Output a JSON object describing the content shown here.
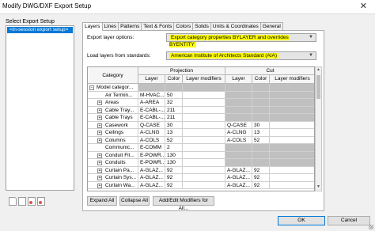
{
  "window": {
    "title": "Modify DWG/DXF Export Setup",
    "close_glyph": "✕"
  },
  "left": {
    "label": "Select Export Setup",
    "items": [
      "<in-session export setup>"
    ]
  },
  "tabs": [
    "Layers",
    "Lines",
    "Patterns",
    "Text & Fonts",
    "Colors",
    "Solids",
    "Units & Coordinates",
    "General"
  ],
  "active_tab": "Layers",
  "export_options": {
    "label": "Export layer options:",
    "value": "Export category properties BYLAYER and overrides BYENTITY"
  },
  "load_layers": {
    "label": "Load layers from standards:",
    "value": "American Institute of Architects Standard (AIA)"
  },
  "table": {
    "header": {
      "category": "Category",
      "projection": "Projection",
      "cut": "Cut",
      "layer": "Layer",
      "color": "Color",
      "layer_modifiers": "Layer modifiers"
    },
    "rows": [
      {
        "level": 0,
        "expander": "−",
        "name": "Model categor...",
        "p_layer": "",
        "p_color": "",
        "c_layer": "",
        "c_color": "",
        "p_grey": false,
        "c_grey": false,
        "section": true
      },
      {
        "level": 1,
        "expander": "",
        "name": "Air Termin...",
        "p_layer": "M-HVAC...",
        "p_color": "50",
        "c_layer": "",
        "c_color": "",
        "c_grey": true
      },
      {
        "level": 1,
        "expander": "+",
        "name": "Areas",
        "p_layer": "A-AREA",
        "p_color": "32",
        "c_layer": "",
        "c_color": "",
        "c_grey": true
      },
      {
        "level": 1,
        "expander": "+",
        "name": "Cable Tray...",
        "p_layer": "E-CABL-...",
        "p_color": "211",
        "c_layer": "",
        "c_color": "",
        "c_grey": true
      },
      {
        "level": 1,
        "expander": "+",
        "name": "Cable Trays",
        "p_layer": "E-CABL-...",
        "p_color": "211",
        "c_layer": "",
        "c_color": "",
        "c_grey": true
      },
      {
        "level": 1,
        "expander": "+",
        "name": "Casework",
        "p_layer": "Q-CASE",
        "p_color": "30",
        "c_layer": "Q-CASE",
        "c_color": "30",
        "c_grey": false
      },
      {
        "level": 1,
        "expander": "+",
        "name": "Ceilings",
        "p_layer": "A-CLNG",
        "p_color": "13",
        "c_layer": "A-CLNG",
        "c_color": "13",
        "c_grey": false
      },
      {
        "level": 1,
        "expander": "+",
        "name": "Columns",
        "p_layer": "A-COLS",
        "p_color": "52",
        "c_layer": "A-COLS",
        "c_color": "52",
        "c_grey": false
      },
      {
        "level": 1,
        "expander": "",
        "name": "Communic...",
        "p_layer": "E-COMM",
        "p_color": "2",
        "c_layer": "",
        "c_color": "",
        "c_grey": true
      },
      {
        "level": 1,
        "expander": "+",
        "name": "Conduit Fit...",
        "p_layer": "E-POWR...",
        "p_color": "130",
        "c_layer": "",
        "c_color": "",
        "c_grey": true
      },
      {
        "level": 1,
        "expander": "+",
        "name": "Conduits",
        "p_layer": "E-POWR...",
        "p_color": "130",
        "c_layer": "",
        "c_color": "",
        "c_grey": true
      },
      {
        "level": 1,
        "expander": "+",
        "name": "Curtain Pa...",
        "p_layer": "A-GLAZ...",
        "p_color": "92",
        "c_layer": "A-GLAZ...",
        "c_color": "92",
        "c_grey": false
      },
      {
        "level": 1,
        "expander": "+",
        "name": "Curtain Sys...",
        "p_layer": "A-GLAZ...",
        "p_color": "92",
        "c_layer": "A-GLAZ...",
        "c_color": "92",
        "c_grey": false
      },
      {
        "level": 1,
        "expander": "+",
        "name": "Curtain Wa...",
        "p_layer": "A-GLAZ...",
        "p_color": "92",
        "c_layer": "A-GLAZ...",
        "c_color": "92",
        "c_grey": false
      }
    ]
  },
  "buttons": {
    "expand_all": "Expand All",
    "collapse_all": "Collapse All",
    "add_edit": "Add/Edit Modifiers for All...",
    "ok": "OK",
    "cancel": "Cancel"
  },
  "left_icons": [
    "new-setup-icon",
    "duplicate-setup-icon",
    "rename-setup-icon",
    "delete-setup-icon"
  ],
  "colors": {
    "highlight": "#ffff00",
    "selection": "#0078d7",
    "grey_cell": "#c0c0c0"
  }
}
